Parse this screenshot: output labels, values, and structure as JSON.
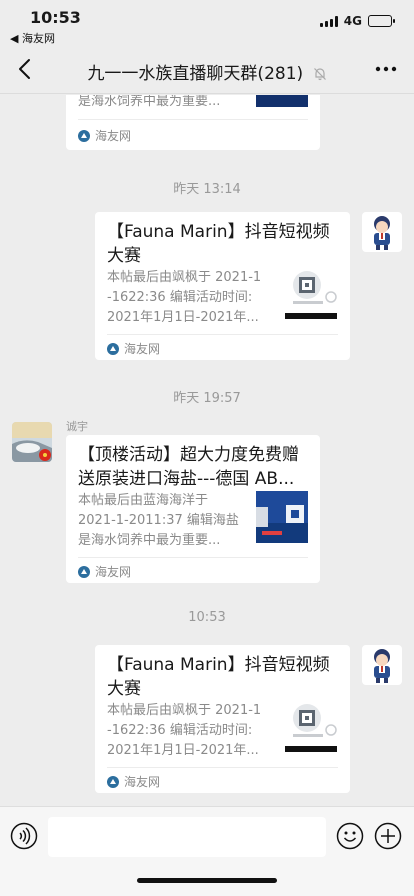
{
  "status_bar": {
    "time": "10:53",
    "back_app": "◀ 海友网",
    "network": "4G",
    "battery_fraction": 0.7
  },
  "nav": {
    "title": "九一一水族直播聊天群(281)",
    "back_icon": "chevron-left-icon",
    "mute_icon": "bell-off-icon",
    "more_icon": "more-dots-icon"
  },
  "messages": [
    {
      "kind": "link-card",
      "desc_lines": [
        "是海水饲养中最为重要..."
      ],
      "source": "海友网"
    },
    {
      "kind": "time",
      "text": "昨天 13:14"
    },
    {
      "kind": "link-card",
      "title_lines": [
        "【Fauna Marin】抖音短视频",
        "大赛"
      ],
      "desc_lines": [
        "本帖最后由飒枫于 2021-1",
        "-1622:36 编辑活动时间:",
        "2021年1月1日-2021年..."
      ],
      "source": "海友网"
    },
    {
      "kind": "time",
      "text": "昨天 19:57"
    },
    {
      "kind": "link-card",
      "sender": "诚宇",
      "title_lines": [
        "【顶楼活动】超大力度免费赠",
        "送原装进口海盐---德国 AB..."
      ],
      "desc_lines": [
        "本帖最后由蓝海海洋于",
        "2021-1-2011:37 编辑海盐",
        "是海水饲养中最为重要..."
      ],
      "source": "海友网"
    },
    {
      "kind": "time",
      "text": "10:53"
    },
    {
      "kind": "link-card",
      "title_lines": [
        "【Fauna Marin】抖音短视频",
        "大赛"
      ],
      "desc_lines": [
        "本帖最后由飒枫于 2021-1",
        "-1622:36 编辑活动时间:",
        "2021年1月1日-2021年..."
      ],
      "source": "海友网"
    }
  ],
  "input_bar": {
    "voice_icon": "voice-icon",
    "emoji_icon": "emoji-icon",
    "plus_icon": "plus-icon",
    "placeholder": ""
  },
  "colors": {
    "background": "#ededed",
    "card": "#ffffff",
    "secondary_text": "#8a8a8a",
    "source_icon": "#2c6e9e"
  }
}
